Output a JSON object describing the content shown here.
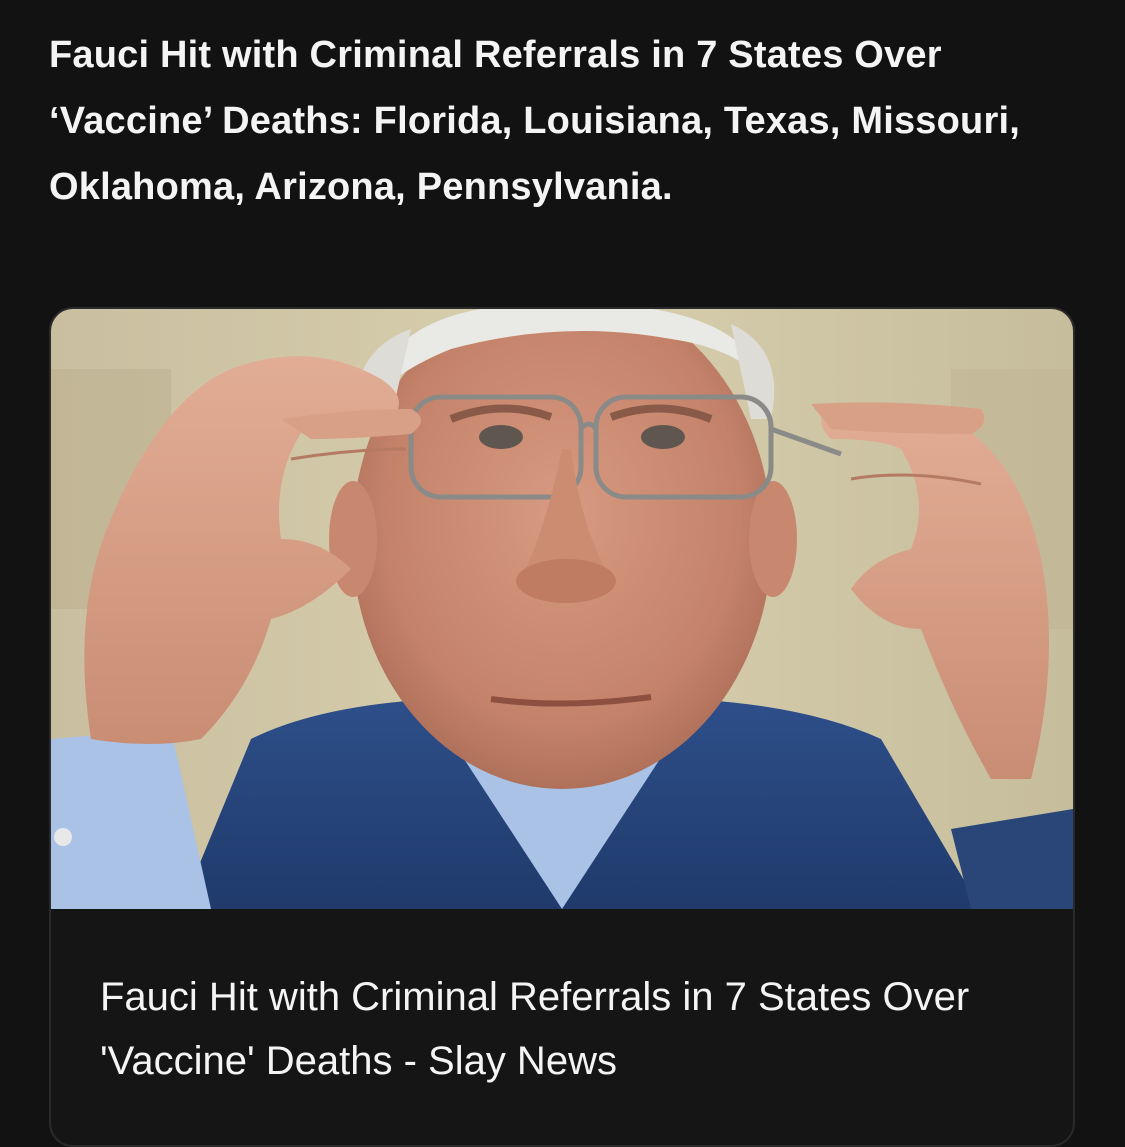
{
  "post": {
    "text": "Fauci Hit with Criminal Referrals in 7 States Over ‘Vaccine’ Deaths: Florida, Louisiana, Texas, Missouri, Oklahoma, Arizona, Pennsylvania."
  },
  "link_card": {
    "image_alt": "Man adjusting glasses with both hands",
    "title": "Fauci Hit with Criminal Referrals in 7 States Over 'Vaccine' Deaths - Slay News"
  },
  "colors": {
    "background": "#121212",
    "text": "#f4f4f4",
    "card_border": "#2a2a2a"
  }
}
